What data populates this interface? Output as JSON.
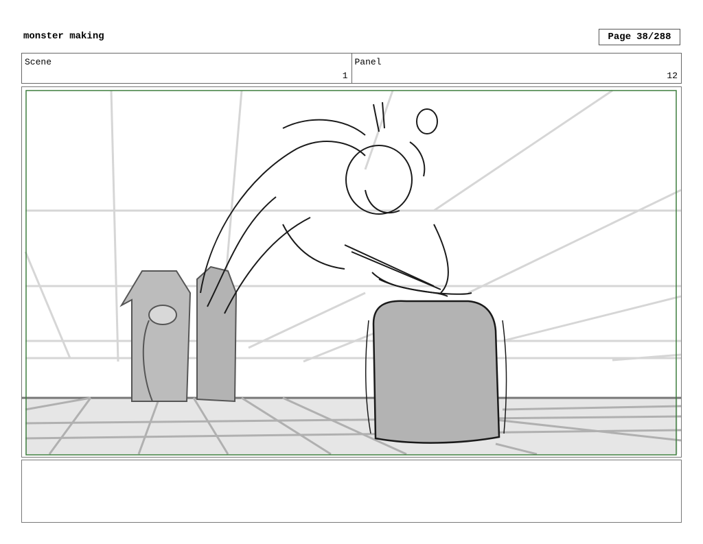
{
  "header": {
    "project_title": "monster making",
    "page_label": "Page",
    "page_number": "38/288"
  },
  "scene": {
    "label": "Scene",
    "value": "1"
  },
  "panel": {
    "label": "Panel",
    "value": "12"
  },
  "colors": {
    "safe_frame": "#3d7d3d",
    "floor": "#e6e6e6",
    "tombstone_fill": "#b3b3b3",
    "guide_lines": "#d6d6d6",
    "ink": "#1a1a1a"
  },
  "notes": {
    "text": ""
  }
}
